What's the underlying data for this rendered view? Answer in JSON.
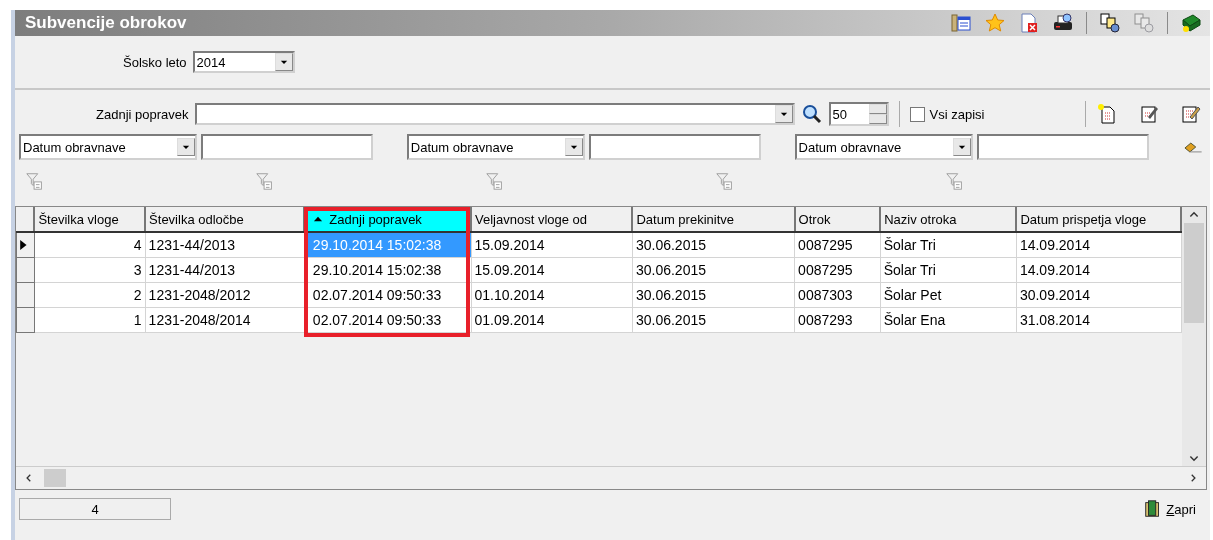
{
  "window": {
    "title": "Subvencije obrokov"
  },
  "school_year": {
    "label": "Šolsko leto",
    "value": "2014"
  },
  "search": {
    "label": "Zadnji popravek",
    "page_size": "50",
    "all_records": {
      "label": "Vsi zapisi",
      "checked": false
    }
  },
  "filters": [
    {
      "field": "Datum obravnave"
    },
    {
      "field": "Datum obravnave"
    },
    {
      "field": "Datum obravnave"
    }
  ],
  "table": {
    "columns": [
      {
        "label": "Številka vloge",
        "kind": "number",
        "sorted": false,
        "focused": false,
        "highlighted": false
      },
      {
        "label": "Številka odločbe",
        "kind": "text",
        "sorted": false,
        "focused": false,
        "highlighted": false
      },
      {
        "label": "Zadnji popravek",
        "kind": "text",
        "sorted": true,
        "focused": true,
        "highlighted": true
      },
      {
        "label": "Veljavnost vloge od",
        "kind": "text",
        "sorted": false,
        "focused": false,
        "highlighted": false
      },
      {
        "label": "Datum prekinitve",
        "kind": "text",
        "sorted": false,
        "focused": false,
        "highlighted": false
      },
      {
        "label": "Otrok",
        "kind": "text",
        "sorted": false,
        "focused": false,
        "highlighted": false
      },
      {
        "label": "Naziv otroka",
        "kind": "text",
        "sorted": false,
        "focused": false,
        "highlighted": false
      },
      {
        "label": "Datum prispetja vloge",
        "kind": "text",
        "sorted": false,
        "focused": false,
        "highlighted": false
      }
    ],
    "rows": [
      {
        "selected": true,
        "cells": [
          "4",
          "1231-44/2013",
          "29.10.2014 15:02:38",
          "15.09.2014",
          "30.06.2015",
          "0087295",
          "Šolar Tri",
          "14.09.2014"
        ]
      },
      {
        "selected": false,
        "cells": [
          "3",
          "1231-44/2013",
          "29.10.2014 15:02:38",
          "15.09.2014",
          "30.06.2015",
          "0087295",
          "Šolar Tri",
          "14.09.2014"
        ]
      },
      {
        "selected": false,
        "cells": [
          "2",
          "1231-2048/2012",
          "02.07.2014 09:50:33",
          "01.10.2014",
          "30.06.2015",
          "0087303",
          "Šolar Pet",
          "30.09.2014"
        ]
      },
      {
        "selected": false,
        "cells": [
          "1",
          "1231-2048/2014",
          "02.07.2014 09:50:33",
          "01.09.2014",
          "30.06.2015",
          "0087293",
          "Šolar Ena",
          "31.08.2014"
        ]
      }
    ]
  },
  "status_bar": {
    "count": "4",
    "close_button": "Zapri"
  }
}
